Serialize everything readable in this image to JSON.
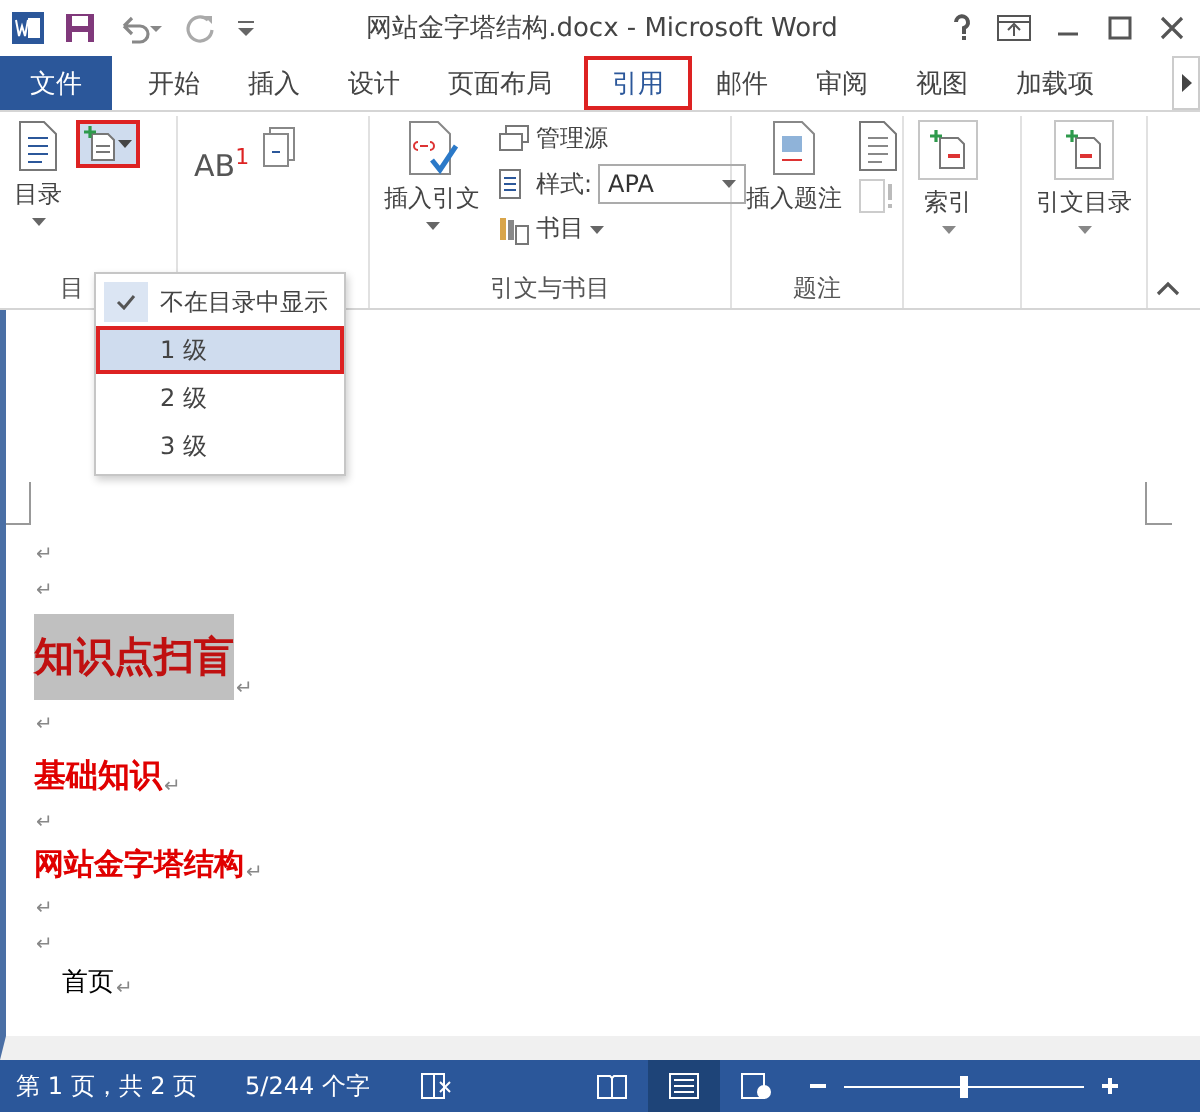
{
  "window": {
    "title": "网站金字塔结构.docx - Microsoft Word"
  },
  "tabs": [
    {
      "label": "文件",
      "kind": "file",
      "selected": false
    },
    {
      "label": "开始",
      "kind": "tab",
      "selected": false
    },
    {
      "label": "插入",
      "kind": "tab",
      "selected": false
    },
    {
      "label": "设计",
      "kind": "tab",
      "selected": false
    },
    {
      "label": "页面布局",
      "kind": "tab",
      "selected": false
    },
    {
      "label": "引用",
      "kind": "tab",
      "selected": true
    },
    {
      "label": "邮件",
      "kind": "tab",
      "selected": false
    },
    {
      "label": "审阅",
      "kind": "tab",
      "selected": false
    },
    {
      "label": "视图",
      "kind": "tab",
      "selected": false
    },
    {
      "label": "加载项",
      "kind": "tab",
      "selected": false
    }
  ],
  "ribbon": {
    "toc_group": {
      "label": "目",
      "toc_button": "目录"
    },
    "footnote_group": {
      "footnote_icon_text": "AB$^{1}$"
    },
    "citations_group": {
      "label": "引文与书目",
      "insert_citation": "插入引文",
      "manage_sources": "管理源",
      "style_label": "样式:",
      "style_value": "APA",
      "bibliography": "书目"
    },
    "captions_group": {
      "label": "题注",
      "insert_caption": "插入题注"
    },
    "index_group": {
      "mark_entry": "索引"
    },
    "toa_group": {
      "mark_citation": "引文目录"
    }
  },
  "add_text_menu": [
    {
      "label": "不在目录中显示",
      "checked": true,
      "selected": false
    },
    {
      "label": "1 级",
      "checked": false,
      "selected": true
    },
    {
      "label": "2 级",
      "checked": false,
      "selected": false
    },
    {
      "label": "3 级",
      "checked": false,
      "selected": false
    }
  ],
  "document": {
    "paragraphs": [
      {
        "kind": "empty",
        "mark": "↵"
      },
      {
        "kind": "empty",
        "mark": "↵"
      },
      {
        "kind": "heading1",
        "text": "知识点扫盲",
        "mark": "↵",
        "highlighted": true
      },
      {
        "kind": "empty",
        "mark": "↵"
      },
      {
        "kind": "heading2",
        "text": "基础知识",
        "mark": "↵"
      },
      {
        "kind": "empty",
        "mark": "↵"
      },
      {
        "kind": "heading3",
        "text": "网站金字塔结构",
        "mark": "↵"
      },
      {
        "kind": "empty",
        "mark": "↵"
      },
      {
        "kind": "empty",
        "mark": "↵"
      },
      {
        "kind": "body",
        "text": "首页",
        "mark": "↵"
      }
    ]
  },
  "status_bar": {
    "page": "第 1 页，共 2 页",
    "words": "5/244 个字",
    "views": [
      {
        "kind": "read",
        "selected": false
      },
      {
        "kind": "print",
        "selected": true
      },
      {
        "kind": "web",
        "selected": false
      }
    ],
    "zoom": {
      "level": 0.5
    }
  }
}
